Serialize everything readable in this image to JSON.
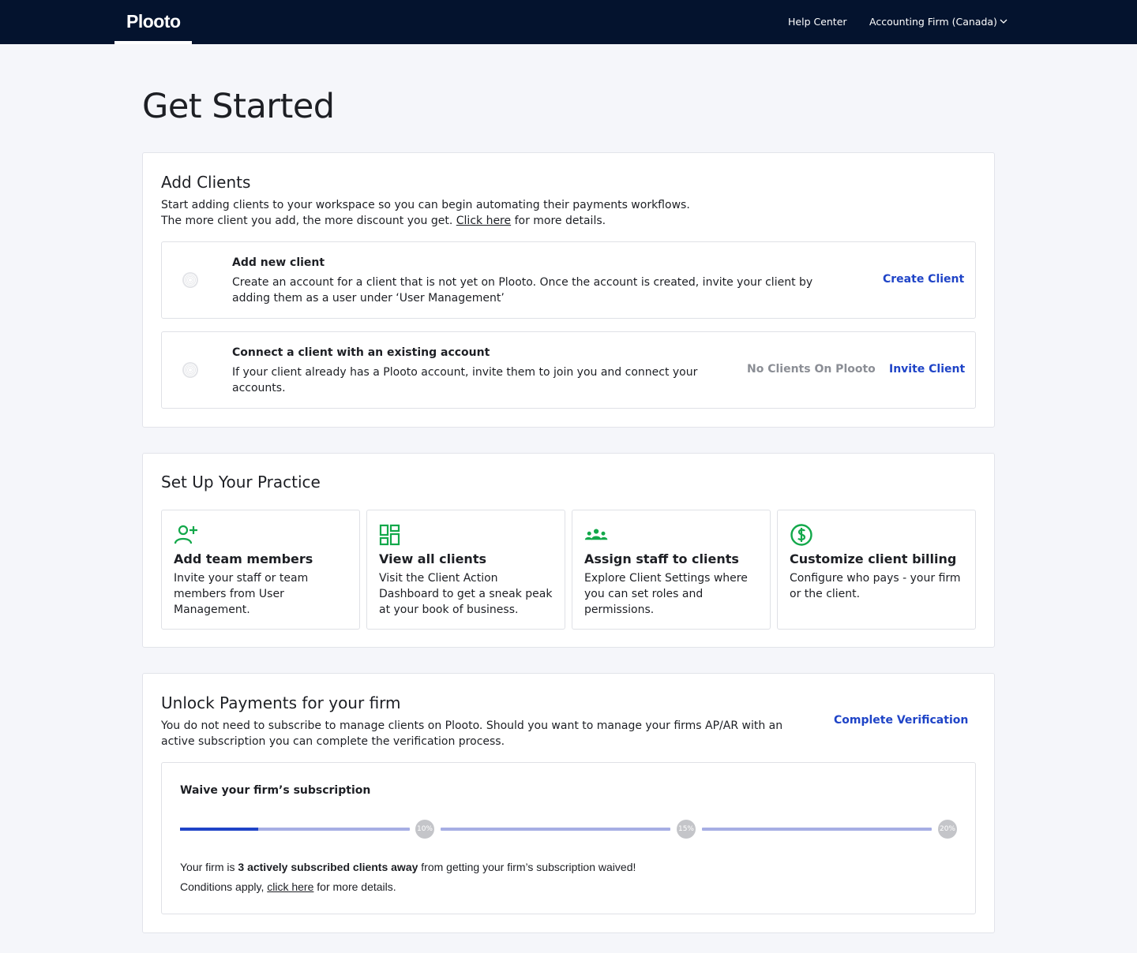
{
  "nav": {
    "logo": "Plooto",
    "help_center": "Help Center",
    "account": "Accounting Firm (Canada)"
  },
  "page_title": "Get Started",
  "add_clients": {
    "title": "Add Clients",
    "line1": "Start adding clients to your workspace so you can begin automating their payments workflows.",
    "line2_prefix": "The more client you add, the more discount you get. ",
    "line2_link": "Click here",
    "line2_suffix": " for more details.",
    "new_client": {
      "title": "Add new client",
      "description": "Create an account for a client that is not yet on Plooto. Once the account is created, invite your client by adding them as a user under ‘User Management’",
      "action": "Create Client"
    },
    "connect_client": {
      "title": "Connect a client with an existing account",
      "description": "If your client already has a Plooto account, invite them to join you and connect your accounts.",
      "status": "No Clients On Plooto",
      "action": "Invite Client"
    }
  },
  "practice": {
    "title": "Set Up Your Practice",
    "accent_color": "#12a84a",
    "tiles": [
      {
        "icon": "add-person-icon",
        "title": "Add team members",
        "description": "Invite your staff or team members from User Management."
      },
      {
        "icon": "dashboard-icon",
        "title": "View all clients",
        "description": "Visit the Client Action Dashboard to get a sneak peak at your book of business."
      },
      {
        "icon": "group-icon",
        "title": "Assign staff to clients",
        "description": "Explore Client Settings where you can set roles and permissions."
      },
      {
        "icon": "dollar-circle-icon",
        "title": "Customize client billing",
        "description": "Configure who pays - your firm or the client."
      }
    ]
  },
  "unlock": {
    "title": "Unlock Payments for your firm",
    "description": "You do not need to subscribe to manage clients on Plooto. Should you want to manage your firms AP/AR with an active subscription you can complete the verification process.",
    "action": "Complete Verification",
    "waive": {
      "title": "Waive your firm’s subscription",
      "progress_first_segment": 0.34,
      "milestones": [
        "10%",
        "15%",
        "20%"
      ],
      "msg_prefix": "Your firm is ",
      "msg_bold": "3 actively subscribed clients away",
      "msg_suffix": " from getting your firm’s subscription waived!",
      "conditions_prefix": "Conditions apply, ",
      "conditions_link": "click here",
      "conditions_suffix": " for more details."
    }
  }
}
